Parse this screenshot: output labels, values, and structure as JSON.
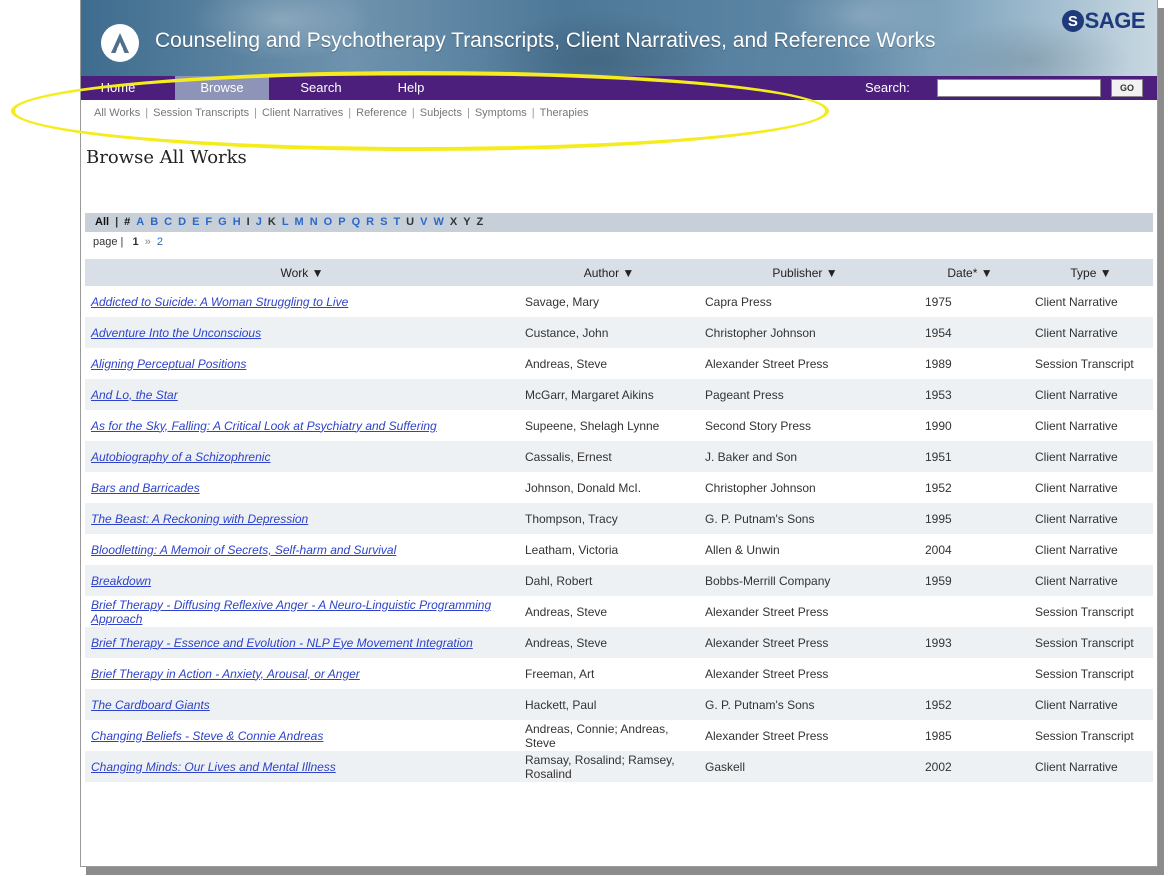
{
  "banner": {
    "title": "Counseling and Psychotherapy Transcripts, Client Narratives, and Reference Works",
    "publisher": "SAGE"
  },
  "nav": {
    "items": [
      "Home",
      "Browse",
      "Search",
      "Help"
    ],
    "active": "Browse",
    "search_label": "Search:",
    "search_value": "",
    "go_label": "GO"
  },
  "subnav": [
    "All Works",
    "Session Transcripts",
    "Client Narratives",
    "Reference",
    "Subjects",
    "Symptoms",
    "Therapies"
  ],
  "page_title": "Browse All Works",
  "alphabet": {
    "all_label": "All",
    "hash_label": "#",
    "letters": [
      "A",
      "B",
      "C",
      "D",
      "E",
      "F",
      "G",
      "H",
      "I",
      "J",
      "K",
      "L",
      "M",
      "N",
      "O",
      "P",
      "Q",
      "R",
      "S",
      "T",
      "U",
      "V",
      "W",
      "X",
      "Y",
      "Z"
    ],
    "disabled": [
      "I",
      "K",
      "U",
      "X",
      "Y",
      "Z"
    ]
  },
  "paging": {
    "label": "page",
    "current": "1",
    "arrow": "»",
    "next": "2"
  },
  "table": {
    "headers": [
      "Work ▼",
      "Author ▼",
      "Publisher ▼",
      "Date* ▼",
      "Type ▼"
    ],
    "rows": [
      {
        "work": "Addicted to Suicide: A Woman Struggling to Live",
        "author": "Savage, Mary",
        "publisher": "Capra Press",
        "date": "1975",
        "type": "Client Narrative"
      },
      {
        "work": "Adventure Into the Unconscious",
        "author": "Custance, John",
        "publisher": "Christopher Johnson",
        "date": "1954",
        "type": "Client Narrative"
      },
      {
        "work": "Aligning Perceptual Positions",
        "author": "Andreas, Steve",
        "publisher": "Alexander Street Press",
        "date": "1989",
        "type": "Session Transcript"
      },
      {
        "work": "And Lo, the Star",
        "author": "McGarr, Margaret Aikins",
        "publisher": "Pageant Press",
        "date": "1953",
        "type": "Client Narrative"
      },
      {
        "work": "As for the Sky, Falling: A Critical Look at Psychiatry and Suffering",
        "author": "Supeene, Shelagh Lynne",
        "publisher": "Second Story Press",
        "date": "1990",
        "type": "Client Narrative"
      },
      {
        "work": "Autobiography of a Schizophrenic",
        "author": "Cassalis, Ernest",
        "publisher": "J. Baker and Son",
        "date": "1951",
        "type": "Client Narrative"
      },
      {
        "work": "Bars and Barricades",
        "author": "Johnson, Donald McI.",
        "publisher": "Christopher Johnson",
        "date": "1952",
        "type": "Client Narrative"
      },
      {
        "work": "The Beast: A Reckoning with Depression",
        "author": "Thompson, Tracy",
        "publisher": "G. P. Putnam's Sons",
        "date": "1995",
        "type": "Client Narrative"
      },
      {
        "work": "Bloodletting: A Memoir of Secrets, Self-harm and Survival",
        "author": "Leatham, Victoria",
        "publisher": "Allen & Unwin",
        "date": "2004",
        "type": "Client Narrative"
      },
      {
        "work": "Breakdown",
        "author": "Dahl, Robert",
        "publisher": "Bobbs-Merrill Company",
        "date": "1959",
        "type": "Client Narrative"
      },
      {
        "work": "Brief Therapy - Diffusing Reflexive Anger - A Neuro-Linguistic Programming Approach",
        "author": "Andreas, Steve",
        "publisher": "Alexander Street Press",
        "date": "",
        "type": "Session Transcript"
      },
      {
        "work": "Brief Therapy - Essence and Evolution - NLP Eye Movement Integration",
        "author": "Andreas, Steve",
        "publisher": "Alexander Street Press",
        "date": "1993",
        "type": "Session Transcript"
      },
      {
        "work": "Brief Therapy in Action - Anxiety, Arousal, or Anger",
        "author": "Freeman, Art",
        "publisher": "Alexander Street Press",
        "date": "",
        "type": "Session Transcript"
      },
      {
        "work": "The Cardboard Giants",
        "author": "Hackett, Paul",
        "publisher": "G. P. Putnam's Sons",
        "date": "1952",
        "type": "Client Narrative"
      },
      {
        "work": "Changing Beliefs - Steve & Connie Andreas",
        "author": "Andreas, Connie; Andreas, Steve",
        "publisher": "Alexander Street Press",
        "date": "1985",
        "type": "Session Transcript"
      },
      {
        "work": "Changing Minds: Our Lives and Mental Illness",
        "author": "Ramsay, Rosalind; Ramsey, Rosalind",
        "publisher": "Gaskell",
        "date": "2002",
        "type": "Client Narrative"
      }
    ]
  },
  "colors": {
    "nav_bg": "#4c1f7d",
    "nav_active": "#8e94b8",
    "link": "#2e43c9",
    "highlight_ellipse": "#f5ec1e"
  }
}
